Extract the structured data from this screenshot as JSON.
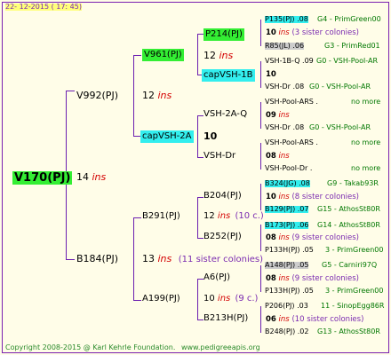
{
  "header": {
    "date": "22- 12-2015 ( 17: 45)"
  },
  "footer": {
    "copyright": "Copyright 2008-2015 @ Karl Kehrle Foundation.",
    "url": "www.pedigreeapis.org"
  },
  "root": {
    "name": "V170(PJ)",
    "num": "14",
    "ins": "ins"
  },
  "gen1": {
    "a": {
      "name": "V992(PJ)",
      "num": "12",
      "ins": "ins"
    },
    "b": {
      "name": "B184(PJ)",
      "num": "13",
      "ins": "ins",
      "sib": "(11 sister colonies)"
    }
  },
  "gen2": {
    "a": {
      "name": "V961(PJ)",
      "num": "12",
      "ins": "ins"
    },
    "b": {
      "name": "capVSH-2A",
      "num": "10"
    },
    "c": {
      "name": "B291(PJ)",
      "num": "12",
      "ins": "ins",
      "sib": "(10 c.)"
    },
    "d": {
      "name": "A199(PJ)",
      "num": "10",
      "ins": "ins",
      "sib": "(9 c.)"
    }
  },
  "gen3": {
    "a": {
      "name": "P214(PJ)"
    },
    "b": {
      "name": "capVSH-1B",
      "num": "10"
    },
    "c": {
      "name": "VSH-2A-Q",
      "num": "09",
      "ins": "ins"
    },
    "d": {
      "name": "VSH-Dr",
      "num": "08",
      "ins": "ins"
    },
    "e": {
      "name": "B204(PJ)",
      "num": "10",
      "ins": "ins"
    },
    "f": {
      "name": "B252(PJ)",
      "num": "08",
      "ins": "ins"
    },
    "g": {
      "name": "A6(PJ)",
      "num": "08",
      "ins": "ins"
    },
    "h": {
      "name": "B213H(PJ)",
      "num": "06",
      "ins": "ins"
    }
  },
  "gen4": [
    {
      "name": "P135(PJ) .08",
      "right": "G4 - PrimGreen00"
    },
    {
      "name": "10",
      "ins": "ins",
      "sib": "(3 sister colonies)"
    },
    {
      "name": "R85(JL) .06",
      "right": "G3 - PrimRed01"
    },
    {
      "name": "VSH-1B-Q .09",
      "right": "G0 - VSH-Pool-AR"
    },
    {
      "name": "VSH-Dr .08",
      "right": "G0 - VSH-Pool-AR"
    },
    {
      "name": "VSH-Pool-ARS .",
      "right": "no more"
    },
    {
      "name": "VSH-Dr .08",
      "right": "G0 - VSH-Pool-AR"
    },
    {
      "name": "VSH-Pool-ARS .",
      "right": "no more"
    },
    {
      "name": "VSH-Pool-Dr .",
      "right": "no more"
    },
    {
      "name": "B324(JG) .08",
      "right": "G9 - Takab93R"
    },
    {
      "name": "10",
      "ins": "ins",
      "sib": "(8 sister colonies)"
    },
    {
      "name": "B129(PJ) .07",
      "right": "G15 - AthosSt80R"
    },
    {
      "name": "B173(PJ) .06",
      "right": "G14 - AthosSt80R"
    },
    {
      "name": "08",
      "ins": "ins",
      "sib": "(9 sister colonies)"
    },
    {
      "name": "P133H(PJ) .05",
      "right": "3 - PrimGreen00"
    },
    {
      "name": "A148(PJ) .05",
      "right": "G5 - Carniri97Q"
    },
    {
      "name": "08",
      "ins": "ins",
      "sib": "(9 sister colonies)"
    },
    {
      "name": "P133H(PJ) .05",
      "right": "3 - PrimGreen00"
    },
    {
      "name": "P206(PJ) .03",
      "right": "11 - SinopEgg86R"
    },
    {
      "name": "06",
      "ins": "ins",
      "sib": "(10 sister colonies)"
    },
    {
      "name": "B248(PJ) .02",
      "right": "G13 - AthosSt80R"
    }
  ]
}
